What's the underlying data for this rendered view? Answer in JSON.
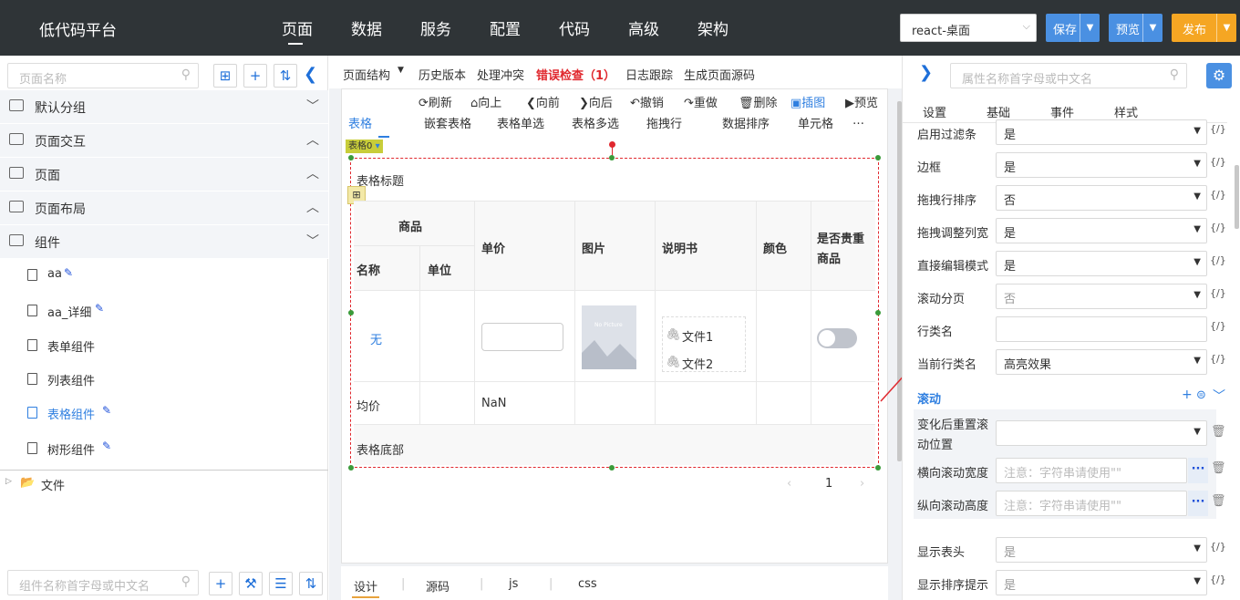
{
  "topbar": {
    "app_title": "低代码平台",
    "nav": [
      "页面",
      "数据",
      "服务",
      "配置",
      "代码",
      "高级",
      "架构"
    ],
    "framework": "react-桌面",
    "save": "保存",
    "preview": "预览",
    "publish": "发布",
    "colors": {
      "bg": "#2f3437",
      "save": "#4a90e2",
      "preview": "#4a90e2",
      "publish": "#f5a623"
    }
  },
  "left": {
    "search_placeholder": "页面名称",
    "groups": [
      {
        "label": "默认分组",
        "expanded": false
      },
      {
        "label": "页面交互",
        "expanded": true
      },
      {
        "label": "页面",
        "expanded": true
      },
      {
        "label": "页面布局",
        "expanded": true
      },
      {
        "label": "组件",
        "expanded": false
      }
    ],
    "items": [
      {
        "label": "aa",
        "edit": true,
        "active": false
      },
      {
        "label": "aa_详细",
        "edit": true,
        "active": false
      },
      {
        "label": "表单组件",
        "edit": false,
        "active": false
      },
      {
        "label": "列表组件",
        "edit": false,
        "active": false
      },
      {
        "label": "表格组件",
        "edit": true,
        "active": true
      },
      {
        "label": "树形组件",
        "edit": true,
        "active": false
      }
    ],
    "folder": "文件",
    "bottom_search_placeholder": "组件名称首字母或中文名"
  },
  "center": {
    "toolbar": [
      "页面结构",
      "历史版本",
      "处理冲突",
      "错误检查（1）",
      "日志跟踪",
      "生成页面源码"
    ],
    "actions": [
      "刷新",
      "向上",
      "向前",
      "向后",
      "撤销",
      "重做",
      "删除",
      "插图",
      "预览"
    ],
    "component_tabs": [
      "表格",
      "嵌套表格",
      "表格单选",
      "表格多选",
      "拖拽行",
      "数据排序",
      "单元格",
      "…"
    ],
    "tag": "表格0",
    "table": {
      "title": "表格标题",
      "group_header": "商品",
      "headers": [
        "名称",
        "单位",
        "单价",
        "图片",
        "说明书",
        "颜色",
        "是否贵重商品"
      ],
      "row": {
        "name": "无",
        "files": [
          "文件1",
          "文件2"
        ],
        "image_text": "No Picture"
      },
      "summary": {
        "label": "均价",
        "value": "NaN"
      },
      "footer": "表格底部"
    },
    "pagination": {
      "page": "1"
    },
    "bottom_tabs": [
      "设计",
      "源码",
      "js",
      "css"
    ]
  },
  "right": {
    "search_placeholder": "属性名称首字母或中文名",
    "tabs": [
      "设置",
      "基础",
      "事件",
      "样式"
    ],
    "props": [
      {
        "label": "启用过滤条",
        "value": "是",
        "disabled": false
      },
      {
        "label": "边框",
        "value": "是",
        "disabled": false
      },
      {
        "label": "拖拽行排序",
        "value": "否",
        "disabled": false
      },
      {
        "label": "拖拽调整列宽",
        "value": "是",
        "disabled": false
      },
      {
        "label": "直接编辑模式",
        "value": "是",
        "disabled": false
      },
      {
        "label": "滚动分页",
        "value": "否",
        "disabled": true
      },
      {
        "label": "行类名",
        "value": "",
        "disabled": false
      },
      {
        "label": "当前行类名",
        "value": "高亮效果",
        "disabled": false
      }
    ],
    "section": "滚动",
    "scroll": {
      "reset_label": "变化后重置滚动位置",
      "h_label": "横向滚动宽度",
      "v_label": "纵向滚动高度",
      "placeholder": "注意：字符串请使用\"\""
    },
    "more_props": [
      {
        "label": "显示表头",
        "value": "是"
      },
      {
        "label": "显示排序提示",
        "value": "是"
      }
    ],
    "fx": "{/}"
  }
}
